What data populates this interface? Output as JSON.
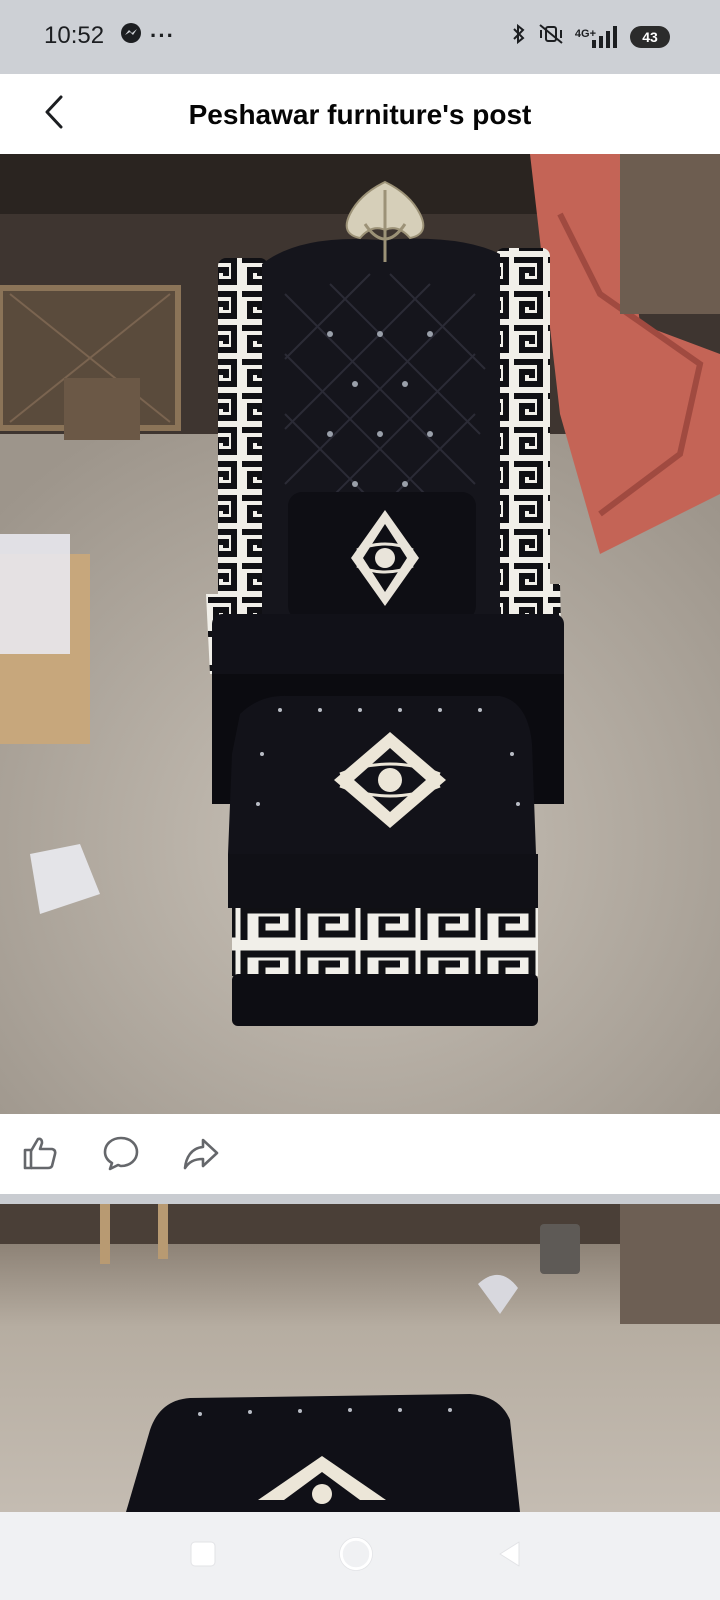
{
  "status_bar": {
    "time": "10:52",
    "more_indicator": "···",
    "network_label": "4G+",
    "battery_level": "43",
    "icons": [
      "messenger-icon",
      "bluetooth-icon",
      "mute-vibrate-icon",
      "signal-icon",
      "battery-icon"
    ]
  },
  "header": {
    "title": "Peshawar furniture's post",
    "back_icon": "chevron-left-icon"
  },
  "post": {
    "photos": [
      "black velvet wingback chair with ottoman",
      "ottoman top view"
    ],
    "actions": [
      {
        "icon": "like-icon"
      },
      {
        "icon": "comment-icon"
      },
      {
        "icon": "share-icon"
      }
    ]
  },
  "nav_bar": {
    "buttons": [
      "recents-icon",
      "home-icon",
      "back-icon"
    ]
  },
  "colors": {
    "status_bar_bg": "#cdd0d5",
    "header_bg": "#ffffff",
    "divider": "#c9ccd1",
    "nav_bg": "#f0f1f3",
    "text": "#050505"
  }
}
